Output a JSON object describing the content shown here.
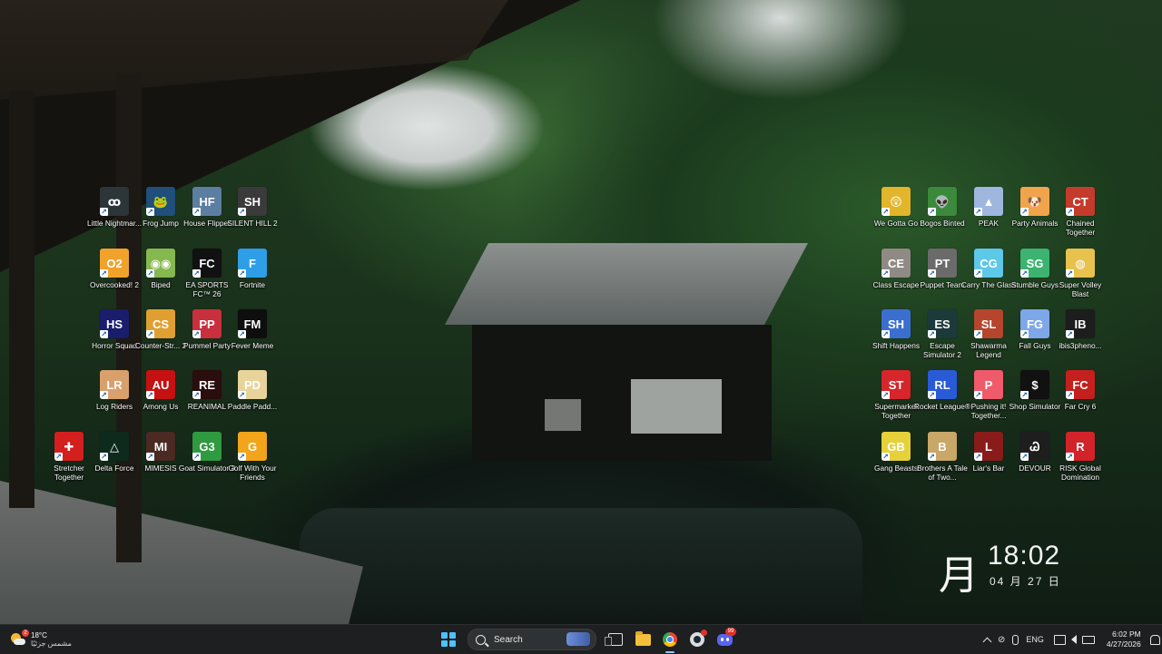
{
  "desktop": {
    "left_icons": [
      {
        "label": "Little Nightmar...",
        "glyph": "ꝏ",
        "color": "#2c3538"
      },
      {
        "label": "Frog Jump",
        "glyph": "🐸",
        "color": "#1f4f7a"
      },
      {
        "label": "House Flipper",
        "glyph": "HF",
        "color": "#5c7ea1"
      },
      {
        "label": "SILENT HILL 2",
        "glyph": "SH",
        "color": "#3a3a3a"
      },
      {
        "label": "Overcooked! 2",
        "glyph": "O2",
        "color": "#f0a22b"
      },
      {
        "label": "Biped",
        "glyph": "◉◉",
        "color": "#86b850"
      },
      {
        "label": "EA SPORTS FC™ 26",
        "glyph": "FC",
        "color": "#111111"
      },
      {
        "label": "Fortnite",
        "glyph": "F",
        "color": "#2e9ee6"
      },
      {
        "label": "Horror Squad",
        "glyph": "HS",
        "color": "#1a1d6b"
      },
      {
        "label": "Counter-Str... 2",
        "glyph": "CS",
        "color": "#e0a031"
      },
      {
        "label": "Pummel Party",
        "glyph": "PP",
        "color": "#c9303d"
      },
      {
        "label": "Fever Meme",
        "glyph": "FM",
        "color": "#0e0e0e"
      },
      {
        "label": "Log Riders",
        "glyph": "LR",
        "color": "#d9a06c"
      },
      {
        "label": "Among Us",
        "glyph": "AU",
        "color": "#c51111"
      },
      {
        "label": "REANIMAL",
        "glyph": "RE",
        "color": "#2a0d0d"
      },
      {
        "label": "Paddle Padd...",
        "glyph": "PD",
        "color": "#e8d49a"
      },
      {
        "label": "Stretcher Together",
        "glyph": "✚",
        "color": "#d41f1f"
      },
      {
        "label": "Delta Force",
        "glyph": "△",
        "color": "#0d2a1c"
      },
      {
        "label": "MIMESIS",
        "glyph": "MI",
        "color": "#4a2a22"
      },
      {
        "label": "Goat Simulator 3",
        "glyph": "G3",
        "color": "#2f9a3f"
      },
      {
        "label": "Golf With Your Friends",
        "glyph": "G",
        "color": "#f2a41a"
      }
    ],
    "right_icons": [
      {
        "label": "We Gotta Go",
        "glyph": "😲",
        "color": "#e2b52b"
      },
      {
        "label": "Bogos Binted",
        "glyph": "👽",
        "color": "#3b8a3b"
      },
      {
        "label": "PEAK",
        "glyph": "▲",
        "color": "#9fb7df"
      },
      {
        "label": "Party Animals",
        "glyph": "🐶",
        "color": "#f0a54c"
      },
      {
        "label": "Chained Together",
        "glyph": "CT",
        "color": "#c43b2c"
      },
      {
        "label": "Class Escape",
        "glyph": "CE",
        "color": "#8f8a84"
      },
      {
        "label": "Puppet Team",
        "glyph": "PT",
        "color": "#6b6b6b"
      },
      {
        "label": "Carry The Glass",
        "glyph": "CG",
        "color": "#5ec8e8"
      },
      {
        "label": "Stumble Guys",
        "glyph": "SG",
        "color": "#3cb371"
      },
      {
        "label": "Super Volley Blast",
        "glyph": "◍",
        "color": "#e7c24c"
      },
      {
        "label": "Shift Happens",
        "glyph": "SH",
        "color": "#3a6fd0"
      },
      {
        "label": "Escape Simulator 2",
        "glyph": "ES",
        "color": "#1c3a3a"
      },
      {
        "label": "Shawarma Legend",
        "glyph": "SL",
        "color": "#b5452c"
      },
      {
        "label": "Fall Guys",
        "glyph": "FG",
        "color": "#7ea7e8"
      },
      {
        "label": "ibis3pheno...",
        "glyph": "IB",
        "color": "#1d1d1d"
      },
      {
        "label": "Supermarket Together",
        "glyph": "ST",
        "color": "#d6262c"
      },
      {
        "label": "Rocket League®",
        "glyph": "RL",
        "color": "#2a5bd7"
      },
      {
        "label": "Pushing it! Together...",
        "glyph": "P",
        "color": "#ef5b6a"
      },
      {
        "label": "Shop Simulator",
        "glyph": "$",
        "color": "#111111"
      },
      {
        "label": "Far Cry 6",
        "glyph": "FC",
        "color": "#c4201e"
      },
      {
        "label": "Gang Beasts",
        "glyph": "GB",
        "color": "#e6d13a"
      },
      {
        "label": "Brothers A Tale of Two...",
        "glyph": "B",
        "color": "#c9a766"
      },
      {
        "label": "Liar's Bar",
        "glyph": "L",
        "color": "#8a1b1b"
      },
      {
        "label": "DEVOUR",
        "glyph": "Ꮚ",
        "color": "#1e1e1e"
      },
      {
        "label": "RISK Global Domination",
        "glyph": "R",
        "color": "#d2232a"
      }
    ]
  },
  "clock_widget": {
    "kanji": "月",
    "time": "18:02",
    "date": "04 月 27 日"
  },
  "taskbar": {
    "weather": {
      "temp": "18°C",
      "desc": "مشمس جزئيًا",
      "badge": "2"
    },
    "search_label": "Search",
    "discord_badge": "99",
    "tray_lang": "ENG",
    "time": "6:02 PM",
    "date": "4/27/2026"
  },
  "colors": {
    "taskbar_bg": "#1d1f20",
    "accent": "#4cc2ff"
  }
}
